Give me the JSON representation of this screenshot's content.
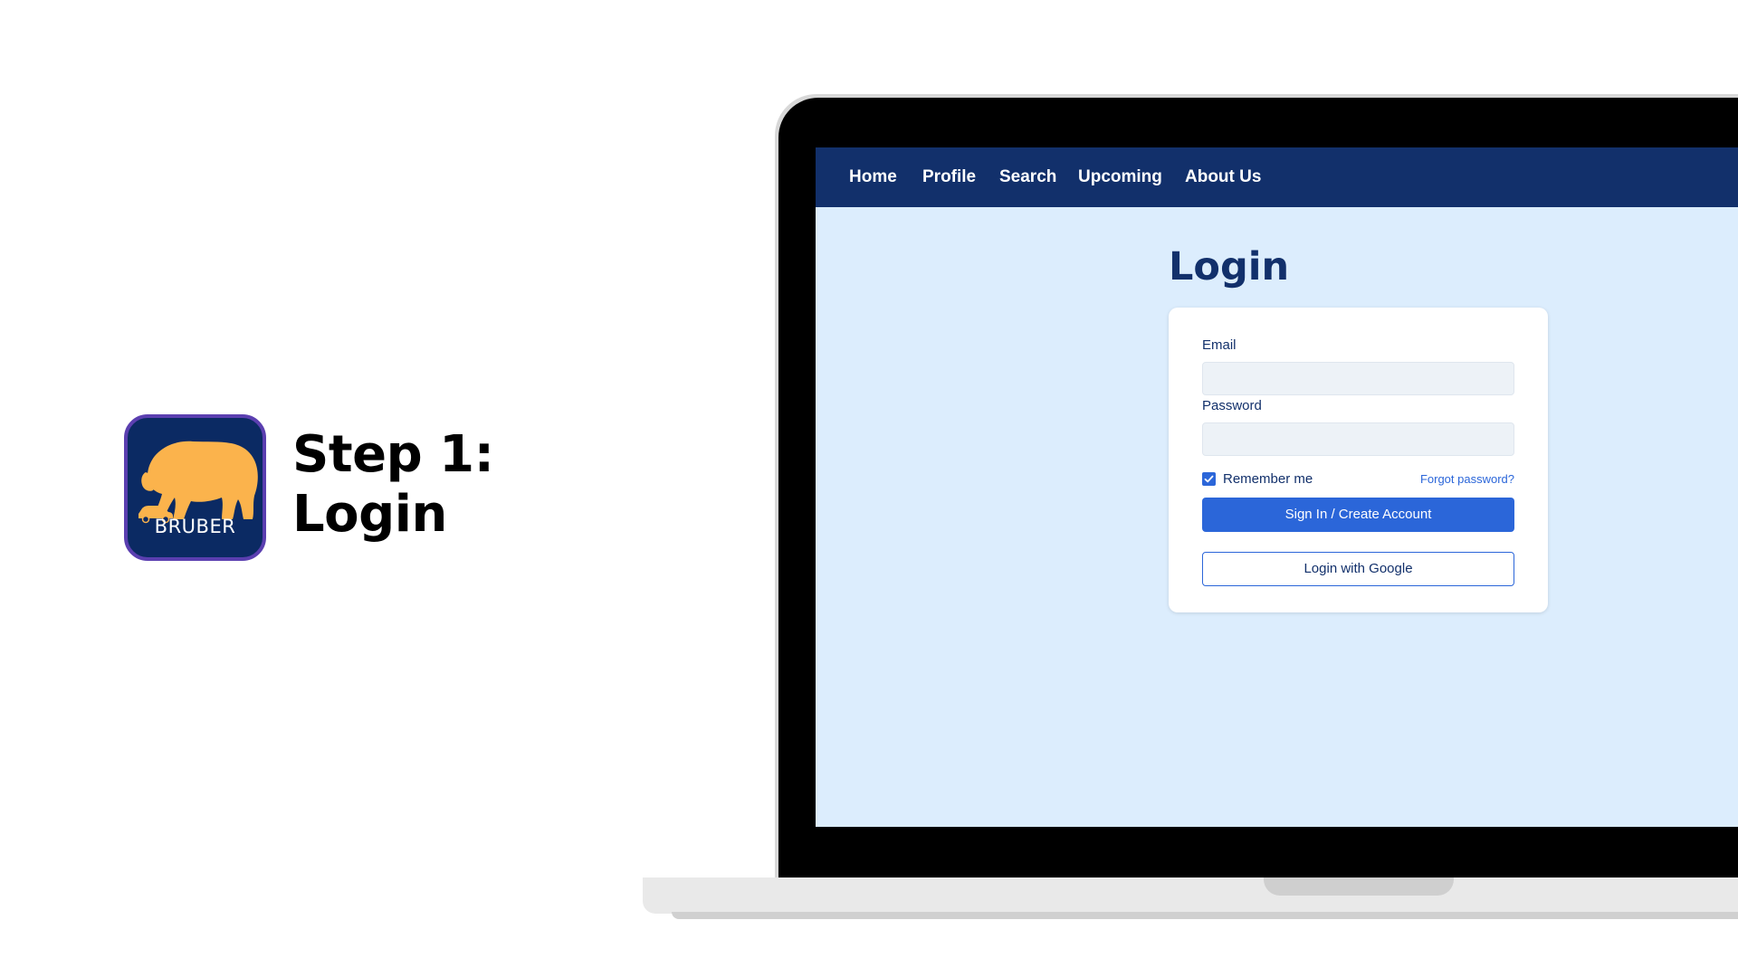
{
  "promo": {
    "app_name": "BRUBER",
    "step_line1": "Step 1:",
    "step_line2": "Login",
    "icon_bg_color": "#0b2a63",
    "icon_border_color": "#5b3fb0",
    "bear_color": "#fbb34c"
  },
  "nav": {
    "items": [
      "Home",
      "Profile",
      "Search",
      "Upcoming",
      "About Us"
    ],
    "bg_color": "#12306b"
  },
  "login": {
    "title": "Login",
    "email_label": "Email",
    "email_value": "",
    "password_label": "Password",
    "password_value": "",
    "remember_label": "Remember me",
    "remember_checked": true,
    "forgot_label": "Forgot password?",
    "signin_label": "Sign In / Create Account",
    "google_label": "Login with Google",
    "accent_color": "#2b66d9",
    "page_bg": "#dcedfd"
  }
}
